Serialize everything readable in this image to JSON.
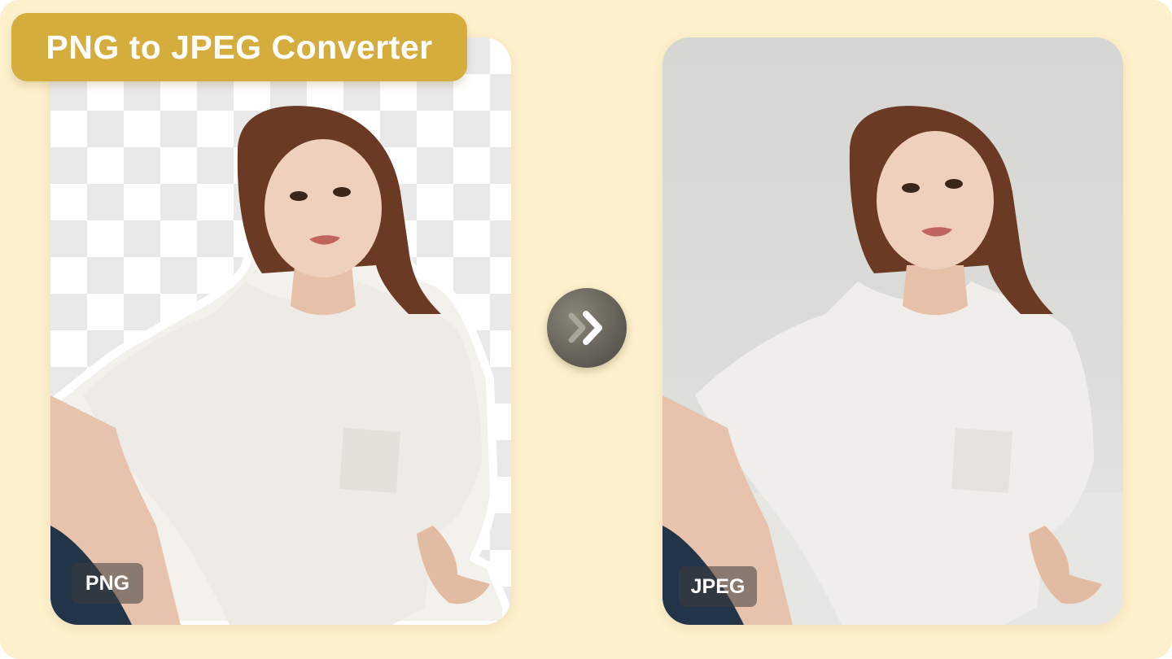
{
  "title": "PNG to JPEG Converter",
  "source_label": "PNG",
  "target_label": "JPEG",
  "icons": {
    "convert": "double-chevron-right-icon"
  },
  "colors": {
    "page_background": "#fdf1cd",
    "title_banner": "#d4ad3c",
    "arrow_button": "#5e5a52",
    "checker_light": "#ffffff",
    "checker_dark": "#e9e9e9",
    "studio_background": "#d8d8d4"
  }
}
